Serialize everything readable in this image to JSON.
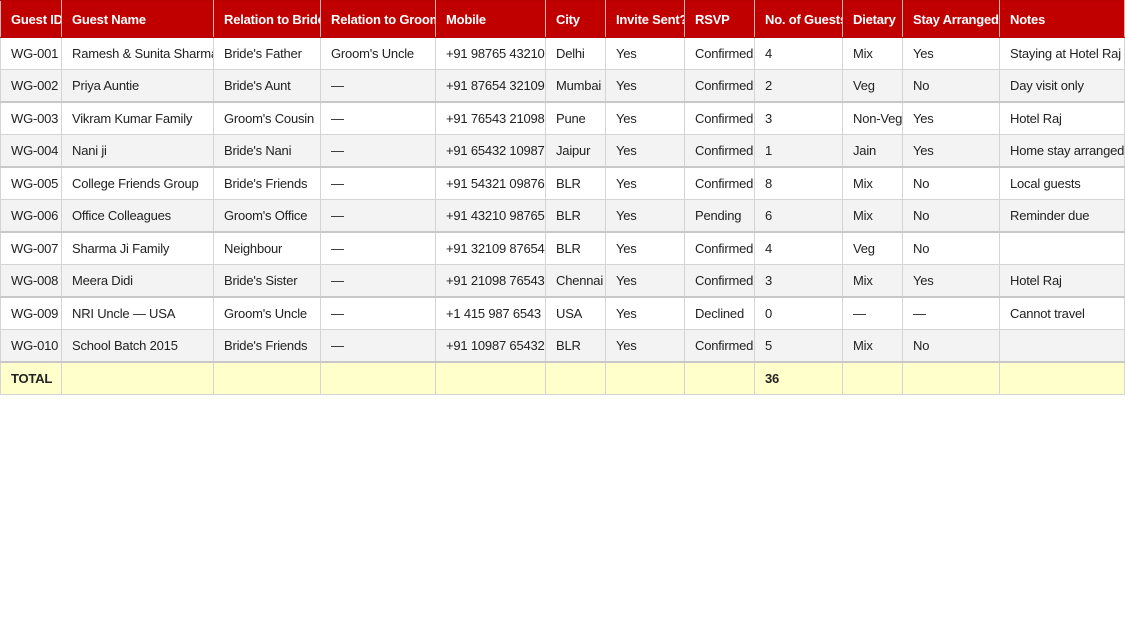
{
  "sheet": {
    "columns": [
      "Guest ID",
      "Guest Name",
      "Relation to Bride",
      "Relation to Groom",
      "Mobile",
      "City",
      "Invite Sent?",
      "RSVP",
      "No. of Guests",
      "Dietary",
      "Stay Arranged?",
      "Notes"
    ],
    "rows": [
      [
        "WG-001",
        "Ramesh & Sunita Sharma",
        "Bride's Father",
        "Groom's Uncle",
        "+91 98765 43210",
        "Delhi",
        "Yes",
        "Confirmed",
        "4",
        "Mix",
        "Yes",
        "Staying at Hotel Raj"
      ],
      [
        "WG-002",
        "Priya Auntie",
        "Bride's Aunt",
        "—",
        "+91 87654 32109",
        "Mumbai",
        "Yes",
        "Confirmed",
        "2",
        "Veg",
        "No",
        "Day visit only"
      ],
      [
        "WG-003",
        "Vikram Kumar Family",
        "Groom's Cousin",
        "—",
        "+91 76543 21098",
        "Pune",
        "Yes",
        "Confirmed",
        "3",
        "Non-Veg",
        "Yes",
        "Hotel Raj"
      ],
      [
        "WG-004",
        "Nani ji",
        "Bride's Nani",
        "—",
        "+91 65432 10987",
        "Jaipur",
        "Yes",
        "Confirmed",
        "1",
        "Jain",
        "Yes",
        "Home stay arranged"
      ],
      [
        "WG-005",
        "College Friends Group",
        "Bride's Friends",
        "—",
        "+91 54321 09876",
        "BLR",
        "Yes",
        "Confirmed",
        "8",
        "Mix",
        "No",
        "Local guests"
      ],
      [
        "WG-006",
        "Office Colleagues",
        "Groom's Office",
        "—",
        "+91 43210 98765",
        "BLR",
        "Yes",
        "Pending",
        "6",
        "Mix",
        "No",
        "Reminder due"
      ],
      [
        "WG-007",
        "Sharma Ji Family",
        "Neighbour",
        "—",
        "+91 32109 87654",
        "BLR",
        "Yes",
        "Confirmed",
        "4",
        "Veg",
        "No",
        ""
      ],
      [
        "WG-008",
        "Meera Didi",
        "Bride's Sister",
        "—",
        "+91 21098 76543",
        "Chennai",
        "Yes",
        "Confirmed",
        "3",
        "Mix",
        "Yes",
        "Hotel Raj"
      ],
      [
        "WG-009",
        "NRI Uncle — USA",
        "Groom's Uncle",
        "—",
        "+1 415 987 6543",
        "USA",
        "Yes",
        "Declined",
        "0",
        "—",
        "—",
        "Cannot travel"
      ],
      [
        "WG-010",
        "School Batch 2015",
        "Bride's Friends",
        "—",
        "+91 10987 65432",
        "BLR",
        "Yes",
        "Confirmed",
        "5",
        "Mix",
        "No",
        ""
      ]
    ],
    "total": {
      "label": "TOTAL",
      "guests": "36"
    }
  },
  "colors": {
    "header_bg": "#c00000",
    "header_text": "#ffffff",
    "row_alt_bg": "#f3f3f3",
    "total_bg": "#ffffcc"
  }
}
